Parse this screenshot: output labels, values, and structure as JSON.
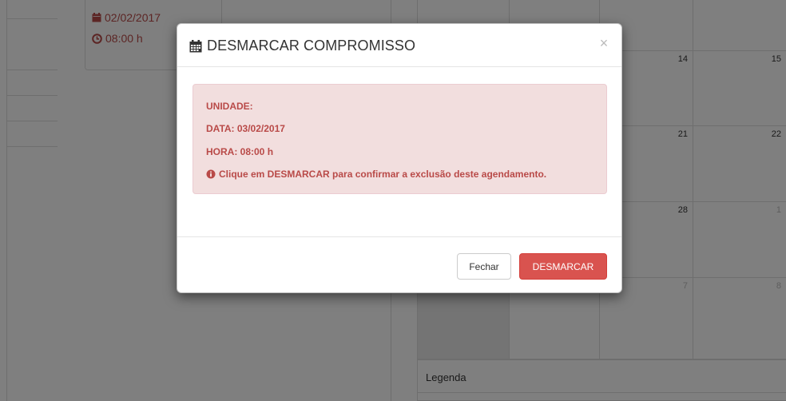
{
  "background": {
    "card": {
      "date": "02/02/2017",
      "time": "08:00 h",
      "date_icon": "calendar-icon",
      "time_icon": "clock-icon"
    },
    "calendar": {
      "rows": [
        [
          {
            "label": "",
            "muted": false,
            "shade": false
          },
          {
            "label": "",
            "muted": false,
            "shade": false
          },
          {
            "label": "",
            "muted": false,
            "shade": false
          },
          {
            "label": "",
            "muted": false,
            "shade": false
          }
        ],
        [
          {
            "label": "",
            "muted": false,
            "shade": false
          },
          {
            "label": "",
            "muted": false,
            "shade": false
          },
          {
            "label": "14",
            "muted": false,
            "shade": false
          },
          {
            "label": "15",
            "muted": false,
            "shade": false
          }
        ],
        [
          {
            "label": "",
            "muted": false,
            "shade": false
          },
          {
            "label": "",
            "muted": false,
            "shade": false
          },
          {
            "label": "21",
            "muted": false,
            "shade": false
          },
          {
            "label": "22",
            "muted": false,
            "shade": false
          }
        ],
        [
          {
            "label": "",
            "muted": false,
            "shade": false
          },
          {
            "label": "",
            "muted": false,
            "shade": false
          },
          {
            "label": "28",
            "muted": false,
            "shade": false
          },
          {
            "label": "1",
            "muted": true,
            "shade": false
          }
        ],
        [
          {
            "label": "",
            "muted": true,
            "shade": true
          },
          {
            "label": "",
            "muted": true,
            "shade": false
          },
          {
            "label": "7",
            "muted": true,
            "shade": false
          },
          {
            "label": "8",
            "muted": true,
            "shade": false
          }
        ]
      ]
    },
    "legend": {
      "title": "Legenda"
    }
  },
  "modal": {
    "title": "DESMARCAR COMPROMISSO",
    "title_icon": "calendar-icon",
    "close_label": "×",
    "alert": {
      "unit": "UNIDADE:",
      "date": "DATA: 03/02/2017",
      "time": "HORA: 08:00 h",
      "notice_icon": "info-circle-icon",
      "notice": "Clique em DESMARCAR para confirmar a exclusão deste agendamento."
    },
    "footer": {
      "close_button": "Fechar",
      "confirm_button": "DESMARCAR"
    }
  },
  "colors": {
    "danger": "#d9534f",
    "alert_bg": "#f2dede",
    "alert_text": "#b94a48"
  }
}
